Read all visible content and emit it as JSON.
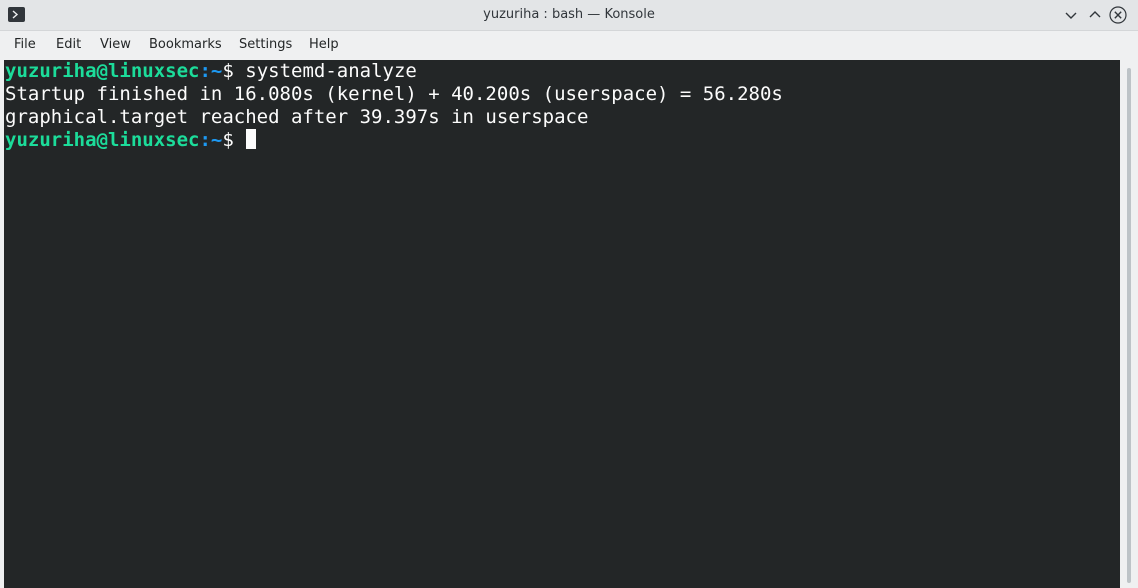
{
  "window": {
    "title": "yuzuriha : bash — Konsole"
  },
  "icons": {
    "app": "terminal-app-icon",
    "minimize": "chevron-down-icon",
    "maximize": "chevron-up-icon",
    "close": "close-circle-icon"
  },
  "menubar": {
    "items": [
      "File",
      "Edit",
      "View",
      "Bookmarks",
      "Settings",
      "Help"
    ]
  },
  "terminal": {
    "lines": [
      {
        "user": "yuzuriha@linuxsec",
        "sep": ":",
        "path": "~",
        "sym": "$ ",
        "command": "systemd-analyze"
      },
      {
        "text": "Startup finished in 16.080s (kernel) + 40.200s (userspace) = 56.280s"
      },
      {
        "text": "graphical.target reached after 39.397s in userspace"
      },
      {
        "user": "yuzuriha@linuxsec",
        "sep": ":",
        "path": "~",
        "sym": "$ ",
        "command": ""
      }
    ]
  },
  "colors": {
    "background": "#232627",
    "text": "#fcfcfc",
    "prompt_user": "#1cdc9a",
    "prompt_path": "#1d99f3"
  }
}
